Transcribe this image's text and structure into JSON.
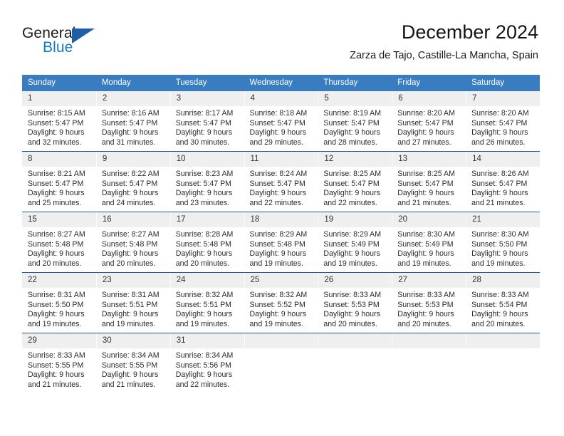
{
  "brand": {
    "word_one": "General",
    "word_two": "Blue",
    "logo_icon": "triangle-logo-icon"
  },
  "header": {
    "month_title": "December 2024",
    "location": "Zarza de Tajo, Castille-La Mancha, Spain"
  },
  "colors": {
    "header_blue": "#3a7cc0",
    "accent_blue": "#1d5fa4",
    "brand_blue": "#1477ca",
    "daynum_band": "#efefef"
  },
  "calendar": {
    "weekday_headers": [
      "Sunday",
      "Monday",
      "Tuesday",
      "Wednesday",
      "Thursday",
      "Friday",
      "Saturday"
    ],
    "weeks": [
      [
        {
          "day": "1",
          "sunrise": "Sunrise: 8:15 AM",
          "sunset": "Sunset: 5:47 PM",
          "daylight_line1": "Daylight: 9 hours",
          "daylight_line2": "and 32 minutes."
        },
        {
          "day": "2",
          "sunrise": "Sunrise: 8:16 AM",
          "sunset": "Sunset: 5:47 PM",
          "daylight_line1": "Daylight: 9 hours",
          "daylight_line2": "and 31 minutes."
        },
        {
          "day": "3",
          "sunrise": "Sunrise: 8:17 AM",
          "sunset": "Sunset: 5:47 PM",
          "daylight_line1": "Daylight: 9 hours",
          "daylight_line2": "and 30 minutes."
        },
        {
          "day": "4",
          "sunrise": "Sunrise: 8:18 AM",
          "sunset": "Sunset: 5:47 PM",
          "daylight_line1": "Daylight: 9 hours",
          "daylight_line2": "and 29 minutes."
        },
        {
          "day": "5",
          "sunrise": "Sunrise: 8:19 AM",
          "sunset": "Sunset: 5:47 PM",
          "daylight_line1": "Daylight: 9 hours",
          "daylight_line2": "and 28 minutes."
        },
        {
          "day": "6",
          "sunrise": "Sunrise: 8:20 AM",
          "sunset": "Sunset: 5:47 PM",
          "daylight_line1": "Daylight: 9 hours",
          "daylight_line2": "and 27 minutes."
        },
        {
          "day": "7",
          "sunrise": "Sunrise: 8:20 AM",
          "sunset": "Sunset: 5:47 PM",
          "daylight_line1": "Daylight: 9 hours",
          "daylight_line2": "and 26 minutes."
        }
      ],
      [
        {
          "day": "8",
          "sunrise": "Sunrise: 8:21 AM",
          "sunset": "Sunset: 5:47 PM",
          "daylight_line1": "Daylight: 9 hours",
          "daylight_line2": "and 25 minutes."
        },
        {
          "day": "9",
          "sunrise": "Sunrise: 8:22 AM",
          "sunset": "Sunset: 5:47 PM",
          "daylight_line1": "Daylight: 9 hours",
          "daylight_line2": "and 24 minutes."
        },
        {
          "day": "10",
          "sunrise": "Sunrise: 8:23 AM",
          "sunset": "Sunset: 5:47 PM",
          "daylight_line1": "Daylight: 9 hours",
          "daylight_line2": "and 23 minutes."
        },
        {
          "day": "11",
          "sunrise": "Sunrise: 8:24 AM",
          "sunset": "Sunset: 5:47 PM",
          "daylight_line1": "Daylight: 9 hours",
          "daylight_line2": "and 22 minutes."
        },
        {
          "day": "12",
          "sunrise": "Sunrise: 8:25 AM",
          "sunset": "Sunset: 5:47 PM",
          "daylight_line1": "Daylight: 9 hours",
          "daylight_line2": "and 22 minutes."
        },
        {
          "day": "13",
          "sunrise": "Sunrise: 8:25 AM",
          "sunset": "Sunset: 5:47 PM",
          "daylight_line1": "Daylight: 9 hours",
          "daylight_line2": "and 21 minutes."
        },
        {
          "day": "14",
          "sunrise": "Sunrise: 8:26 AM",
          "sunset": "Sunset: 5:47 PM",
          "daylight_line1": "Daylight: 9 hours",
          "daylight_line2": "and 21 minutes."
        }
      ],
      [
        {
          "day": "15",
          "sunrise": "Sunrise: 8:27 AM",
          "sunset": "Sunset: 5:48 PM",
          "daylight_line1": "Daylight: 9 hours",
          "daylight_line2": "and 20 minutes."
        },
        {
          "day": "16",
          "sunrise": "Sunrise: 8:27 AM",
          "sunset": "Sunset: 5:48 PM",
          "daylight_line1": "Daylight: 9 hours",
          "daylight_line2": "and 20 minutes."
        },
        {
          "day": "17",
          "sunrise": "Sunrise: 8:28 AM",
          "sunset": "Sunset: 5:48 PM",
          "daylight_line1": "Daylight: 9 hours",
          "daylight_line2": "and 20 minutes."
        },
        {
          "day": "18",
          "sunrise": "Sunrise: 8:29 AM",
          "sunset": "Sunset: 5:48 PM",
          "daylight_line1": "Daylight: 9 hours",
          "daylight_line2": "and 19 minutes."
        },
        {
          "day": "19",
          "sunrise": "Sunrise: 8:29 AM",
          "sunset": "Sunset: 5:49 PM",
          "daylight_line1": "Daylight: 9 hours",
          "daylight_line2": "and 19 minutes."
        },
        {
          "day": "20",
          "sunrise": "Sunrise: 8:30 AM",
          "sunset": "Sunset: 5:49 PM",
          "daylight_line1": "Daylight: 9 hours",
          "daylight_line2": "and 19 minutes."
        },
        {
          "day": "21",
          "sunrise": "Sunrise: 8:30 AM",
          "sunset": "Sunset: 5:50 PM",
          "daylight_line1": "Daylight: 9 hours",
          "daylight_line2": "and 19 minutes."
        }
      ],
      [
        {
          "day": "22",
          "sunrise": "Sunrise: 8:31 AM",
          "sunset": "Sunset: 5:50 PM",
          "daylight_line1": "Daylight: 9 hours",
          "daylight_line2": "and 19 minutes."
        },
        {
          "day": "23",
          "sunrise": "Sunrise: 8:31 AM",
          "sunset": "Sunset: 5:51 PM",
          "daylight_line1": "Daylight: 9 hours",
          "daylight_line2": "and 19 minutes."
        },
        {
          "day": "24",
          "sunrise": "Sunrise: 8:32 AM",
          "sunset": "Sunset: 5:51 PM",
          "daylight_line1": "Daylight: 9 hours",
          "daylight_line2": "and 19 minutes."
        },
        {
          "day": "25",
          "sunrise": "Sunrise: 8:32 AM",
          "sunset": "Sunset: 5:52 PM",
          "daylight_line1": "Daylight: 9 hours",
          "daylight_line2": "and 19 minutes."
        },
        {
          "day": "26",
          "sunrise": "Sunrise: 8:33 AM",
          "sunset": "Sunset: 5:53 PM",
          "daylight_line1": "Daylight: 9 hours",
          "daylight_line2": "and 20 minutes."
        },
        {
          "day": "27",
          "sunrise": "Sunrise: 8:33 AM",
          "sunset": "Sunset: 5:53 PM",
          "daylight_line1": "Daylight: 9 hours",
          "daylight_line2": "and 20 minutes."
        },
        {
          "day": "28",
          "sunrise": "Sunrise: 8:33 AM",
          "sunset": "Sunset: 5:54 PM",
          "daylight_line1": "Daylight: 9 hours",
          "daylight_line2": "and 20 minutes."
        }
      ],
      [
        {
          "day": "29",
          "sunrise": "Sunrise: 8:33 AM",
          "sunset": "Sunset: 5:55 PM",
          "daylight_line1": "Daylight: 9 hours",
          "daylight_line2": "and 21 minutes."
        },
        {
          "day": "30",
          "sunrise": "Sunrise: 8:34 AM",
          "sunset": "Sunset: 5:55 PM",
          "daylight_line1": "Daylight: 9 hours",
          "daylight_line2": "and 21 minutes."
        },
        {
          "day": "31",
          "sunrise": "Sunrise: 8:34 AM",
          "sunset": "Sunset: 5:56 PM",
          "daylight_line1": "Daylight: 9 hours",
          "daylight_line2": "and 22 minutes."
        },
        {
          "day": "",
          "sunrise": "",
          "sunset": "",
          "daylight_line1": "",
          "daylight_line2": ""
        },
        {
          "day": "",
          "sunrise": "",
          "sunset": "",
          "daylight_line1": "",
          "daylight_line2": ""
        },
        {
          "day": "",
          "sunrise": "",
          "sunset": "",
          "daylight_line1": "",
          "daylight_line2": ""
        },
        {
          "day": "",
          "sunrise": "",
          "sunset": "",
          "daylight_line1": "",
          "daylight_line2": ""
        }
      ]
    ]
  }
}
